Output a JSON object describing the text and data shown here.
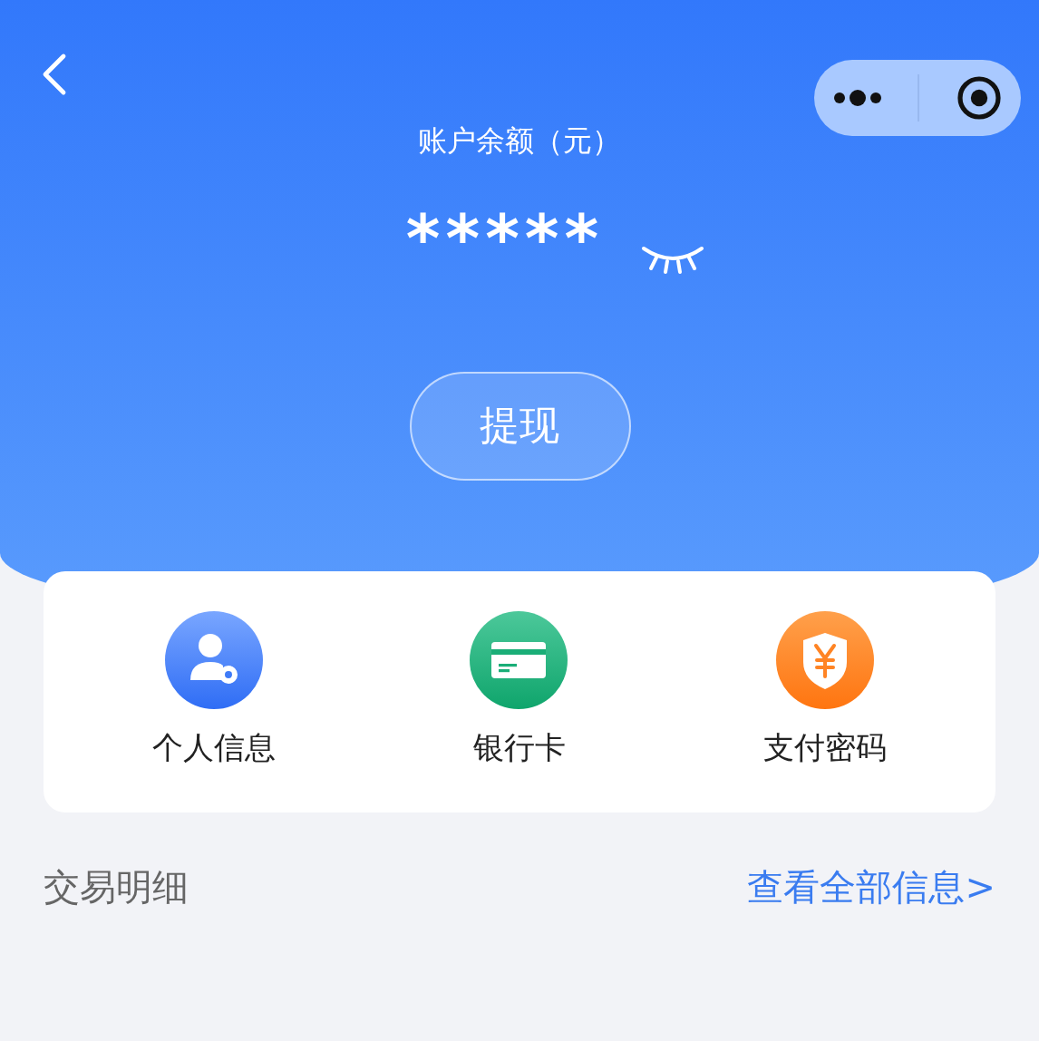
{
  "header": {
    "title": "账户余额（元）",
    "balance": "*****",
    "balance_hidden": true,
    "withdraw_button": "提现"
  },
  "shortcuts": [
    {
      "kind": "profile",
      "label": "个人信息"
    },
    {
      "kind": "card",
      "label": "银行卡"
    },
    {
      "kind": "payment-password",
      "label": "支付密码"
    }
  ],
  "transactions": {
    "title": "交易明细",
    "link": "查看全部信息>"
  }
}
